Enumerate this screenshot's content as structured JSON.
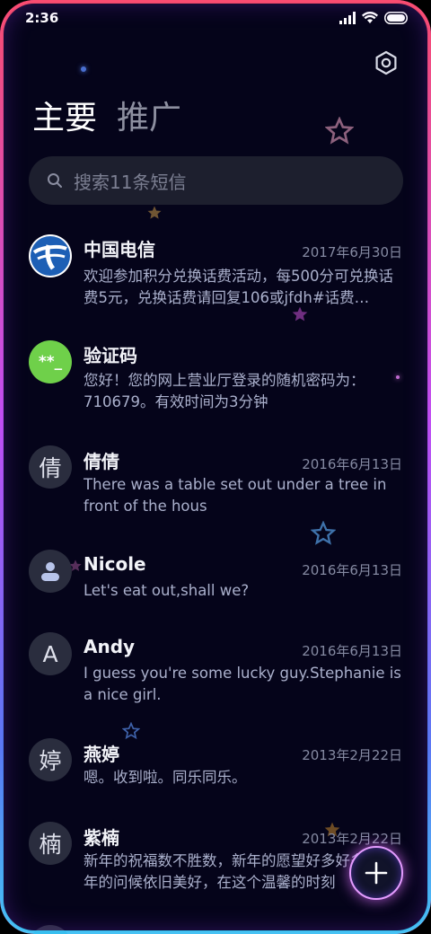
{
  "status_bar": {
    "time": "2:36"
  },
  "tabs": [
    {
      "label": "主要",
      "active": true
    },
    {
      "label": "推广",
      "active": false
    }
  ],
  "search": {
    "placeholder": "搜索11条短信"
  },
  "conversations": [
    {
      "avatar_text": "",
      "avatar_type": "telecom-logo",
      "name": "中国电信",
      "date": "2017年6月30日",
      "preview": "欢迎参加积分兑换话费活动，每500分可兑换话费5元，兑换话费请回复106或jfdh#话费…"
    },
    {
      "avatar_text": "**_",
      "avatar_type": "code",
      "name": "验证码",
      "date": "",
      "preview": "您好！您的网上营业厅登录的随机密码为：710679。有效时间为3分钟"
    },
    {
      "avatar_text": "倩",
      "avatar_type": "letter",
      "name": "倩倩",
      "date": "2016年6月13日",
      "preview": "There was a table set out under a tree in front of the hous"
    },
    {
      "avatar_text": "",
      "avatar_type": "person",
      "name": "Nicole",
      "date": "2016年6月13日",
      "preview": "Let's eat out,shall we?"
    },
    {
      "avatar_text": "A",
      "avatar_type": "letter",
      "name": "Andy",
      "date": "2016年6月13日",
      "preview": "I guess you're some lucky guy.Stephanie is a nice girl."
    },
    {
      "avatar_text": "婷",
      "avatar_type": "letter",
      "name": "燕婷",
      "date": "2013年2月22日",
      "preview": "嗯。收到啦。同乐同乐。"
    },
    {
      "avatar_text": "楠",
      "avatar_type": "letter",
      "name": "紫楠",
      "date": "2013年2月22日",
      "preview": "新年的祝福数不胜数，新年的愿望好多好多，新年的问候依旧美好，在这个温馨的时刻"
    }
  ],
  "colors": {
    "background": "#05041a",
    "code_avatar": "#6fd04a",
    "telecom_blue": "#1d5fb5",
    "fab_ring": "#e49cff"
  }
}
